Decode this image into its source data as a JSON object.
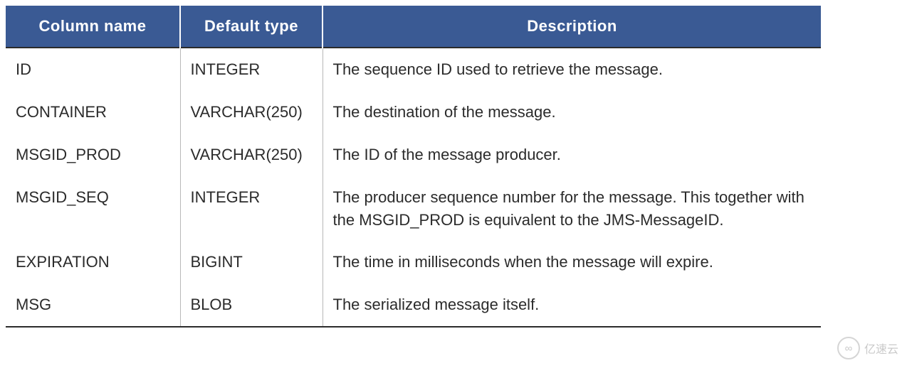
{
  "table": {
    "headers": {
      "column_name": "Column name",
      "default_type": "Default type",
      "description": "Description"
    },
    "rows": [
      {
        "name": "ID",
        "type": "INTEGER",
        "desc": "The sequence ID used to retrieve the message."
      },
      {
        "name": "CONTAINER",
        "type": "VARCHAR(250)",
        "desc": "The destination of the message."
      },
      {
        "name": "MSGID_PROD",
        "type": "VARCHAR(250)",
        "desc": "The ID of the message producer."
      },
      {
        "name": "MSGID_SEQ",
        "type": "INTEGER",
        "desc": "The producer sequence number for the message. This together with the MSGID_PROD is equivalent to the JMS-MessageID."
      },
      {
        "name": "EXPIRATION",
        "type": "BIGINT",
        "desc": "The time in milliseconds when the message will expire."
      },
      {
        "name": "MSG",
        "type": "BLOB",
        "desc": "The serialized message itself."
      }
    ]
  },
  "watermark": {
    "text": "亿速云",
    "icon": "∞"
  }
}
